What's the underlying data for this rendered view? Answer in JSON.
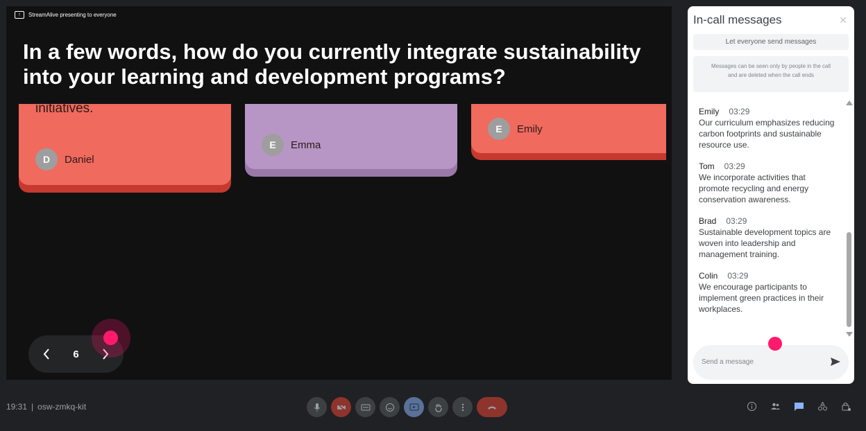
{
  "presenting": {
    "label": "StreamAlive presenting to everyone",
    "icon": "present-screen-icon"
  },
  "slide": {
    "question": "In a few words, how do you currently integrate sustainability into your learning and development programs?",
    "cards": [
      {
        "snippet": "initiatives.",
        "initial": "D",
        "name": "Daniel",
        "color": "#f06a5e"
      },
      {
        "snippet": "",
        "initial": "E",
        "name": "Emma",
        "color": "#b796c5"
      },
      {
        "snippet": "",
        "initial": "E",
        "name": "Emily",
        "color": "#f06a5e"
      }
    ],
    "pager": {
      "page": "6",
      "prev_icon": "chevron-left-icon",
      "next_icon": "chevron-right-icon"
    },
    "cursor_color": "#ff1a6d"
  },
  "panel": {
    "title": "In-call messages",
    "toggle_label": "Let everyone send messages",
    "notice": "Messages can be seen only by people in the call and are deleted when the call ends",
    "messages": [
      {
        "sender": "Emily",
        "time": "03:29",
        "text": "Our curriculum emphasizes reducing carbon footprints and sustainable resource use."
      },
      {
        "sender": "Tom",
        "time": "03:29",
        "text": "We incorporate activities that promote recycling and energy conservation awareness."
      },
      {
        "sender": "Brad",
        "time": "03:29",
        "text": "Sustainable development topics are woven into leadership and management training."
      },
      {
        "sender": "Colin",
        "time": "03:29",
        "text": "We encourage participants to implement green practices in their workplaces."
      }
    ],
    "input_placeholder": "Send a message"
  },
  "bottombar": {
    "time": "19:31",
    "separator": "|",
    "meeting_code": "osw-zmkq-kit",
    "controls": [
      "mic-icon",
      "camera-off-icon",
      "captions-icon",
      "emoji-icon",
      "present-icon",
      "raise-hand-icon",
      "more-options-icon",
      "hang-up-icon"
    ],
    "right_icons": [
      "info-icon",
      "people-icon",
      "chat-icon",
      "activities-icon",
      "host-controls-icon"
    ]
  }
}
